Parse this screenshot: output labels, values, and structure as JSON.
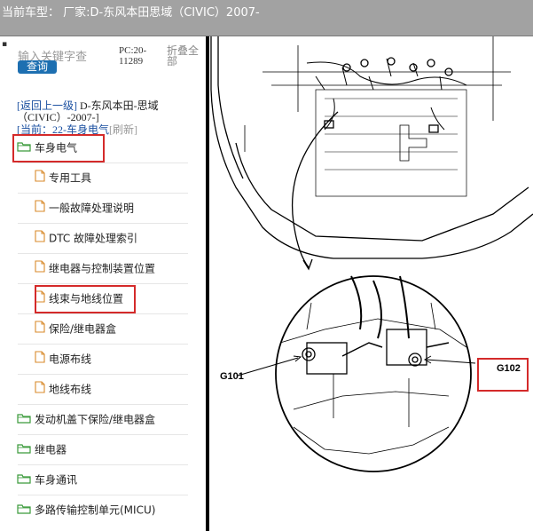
{
  "header": {
    "title": "当前车型：  厂家:D-东风本田思域（CIVIC）2007-"
  },
  "sidebar": {
    "search_placeholder": "输入关键字查",
    "query_button": "查询",
    "pc_code": "PC:20-11289",
    "collapse_all": "折叠全部",
    "back_prefix": "[返回上一级]",
    "back_model": "D-东风本田-思域（CIVIC）-2007-]",
    "current_prefix": "[当前：",
    "current_value": "22-车身电气",
    "refresh": "[刷新]",
    "tree": [
      {
        "label": "车身电气",
        "type": "folder",
        "level": 0,
        "highlighted": true
      },
      {
        "label": "专用工具",
        "type": "doc",
        "level": 1
      },
      {
        "label": "一般故障处理说明",
        "type": "doc",
        "level": 1
      },
      {
        "label": "DTC 故障处理索引",
        "type": "doc",
        "level": 1
      },
      {
        "label": "继电器与控制装置位置",
        "type": "doc",
        "level": 1
      },
      {
        "label": "线束与地线位置",
        "type": "doc",
        "level": 1,
        "highlighted": true
      },
      {
        "label": "保险/继电器盒",
        "type": "doc",
        "level": 1
      },
      {
        "label": "电源布线",
        "type": "doc",
        "level": 1
      },
      {
        "label": "地线布线",
        "type": "doc",
        "level": 1
      },
      {
        "label": "发动机盖下保险/继电器盒",
        "type": "folder",
        "level": 0
      },
      {
        "label": "继电器",
        "type": "folder",
        "level": 0
      },
      {
        "label": "车身通讯",
        "type": "folder",
        "level": 0
      },
      {
        "label": "多路传输控制单元(MICU)",
        "type": "folder",
        "level": 0
      }
    ]
  },
  "diagram": {
    "label_left": "G101",
    "label_right": "G102"
  },
  "colors": {
    "folder": "#3a9a3a",
    "doc": "#d88a2a",
    "link": "#1a4fa0",
    "highlight": "#d42a2a",
    "topbar": "#a2a2a2"
  }
}
